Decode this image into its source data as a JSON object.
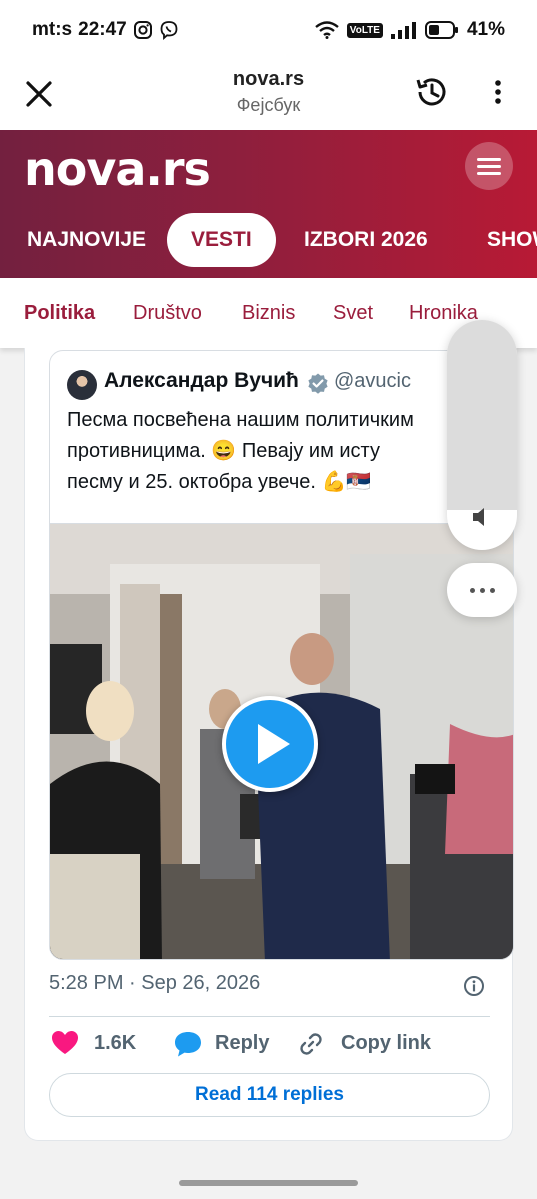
{
  "status_bar": {
    "carrier": "mt:s",
    "time": "22:47",
    "battery": "41%",
    "network_badge": "VoLTE"
  },
  "browser_bar": {
    "title": "nova.rs",
    "subtitle": "Фејсбук",
    "icons": [
      "close-icon",
      "history-icon",
      "more-vertical-icon"
    ]
  },
  "site_header": {
    "logo": "nova.rs",
    "tabs": [
      {
        "label": "NAJNOVIJE",
        "active": false
      },
      {
        "label": "VESTI",
        "active": true
      },
      {
        "label": "IZBORI 2026",
        "active": false
      },
      {
        "label": "SHOW",
        "active": false
      }
    ]
  },
  "sub_nav": {
    "items": [
      {
        "label": "Politika",
        "active": true
      },
      {
        "label": "Društvo",
        "active": false
      },
      {
        "label": "Biznis",
        "active": false
      },
      {
        "label": "Svet",
        "active": false
      },
      {
        "label": "Hronika",
        "active": false
      }
    ]
  },
  "tweet": {
    "author": "Александар Вучић",
    "handle": "@avucic",
    "text_line1": "Песма посвећена нашим политичким",
    "text_line2": "противницима. 😄 Певају им исту",
    "text_line3": "песму и 25. октобра увече. 💪🇷🇸",
    "time": "5:28 PM",
    "date": "Sep 26, 2026",
    "likes": "1.6K",
    "reply_label": "Reply",
    "copy_link_label": "Copy link",
    "read_replies_label": "Read 114 replies"
  },
  "colors": {
    "brand": "#9a1d3c",
    "twitter_blue": "#1d9bf0",
    "like_pink": "#f91880"
  }
}
